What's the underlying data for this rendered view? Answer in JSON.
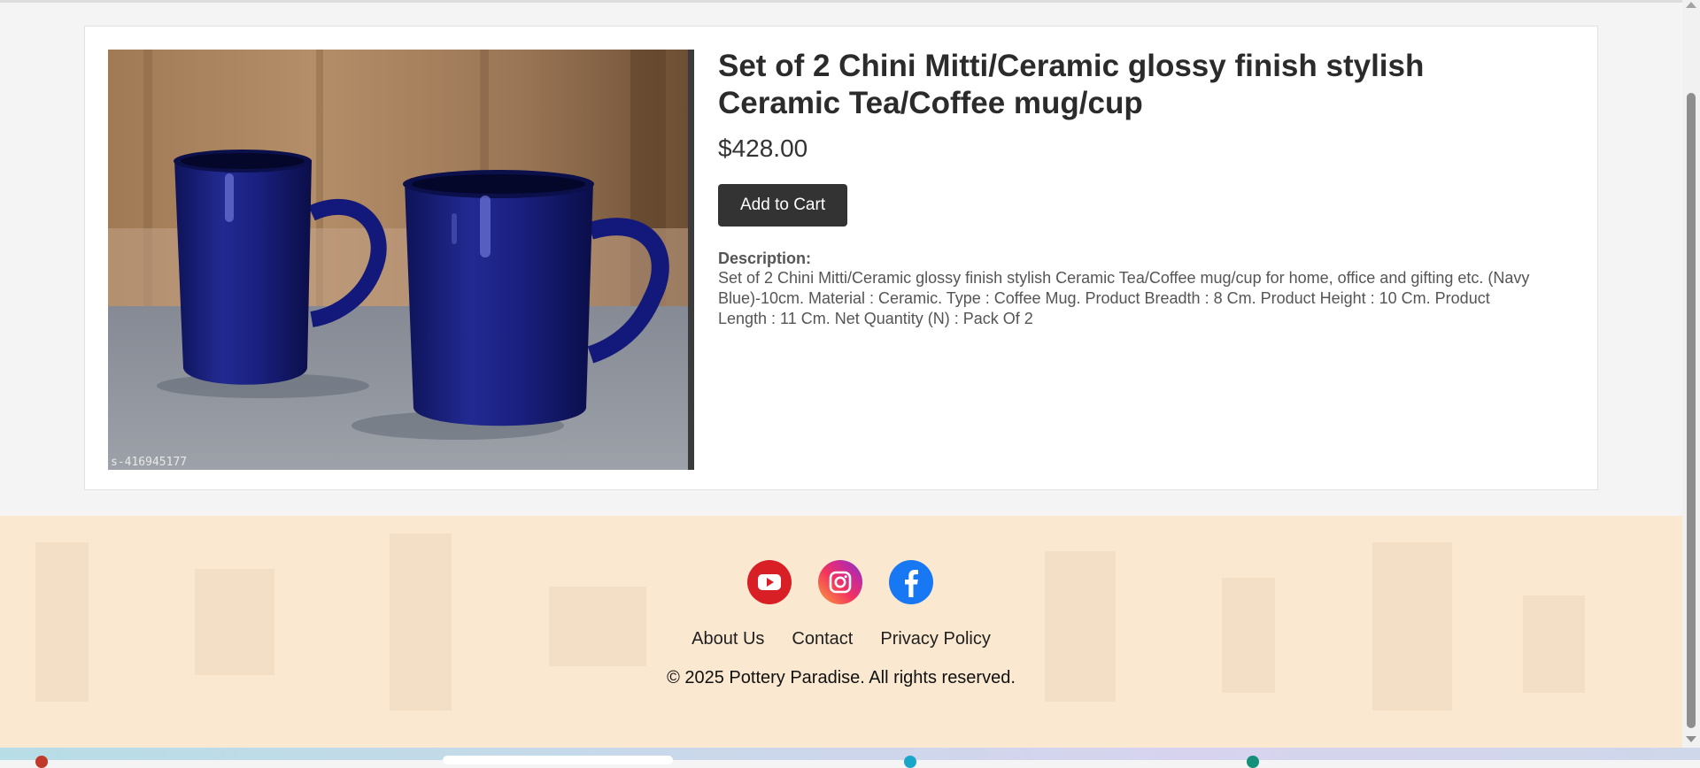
{
  "product": {
    "title": "Set of 2 Chini Mitti/Ceramic glossy finish stylish Ceramic Tea/Coffee mug/cup",
    "price": "$428.00",
    "add_to_cart_label": "Add to Cart",
    "description_label": "Description:",
    "description": "Set of 2 Chini Mitti/Ceramic glossy finish stylish Ceramic Tea/Coffee mug/cup for home, office and gifting etc. (Navy Blue)-10cm. Material : Ceramic. Type : Coffee Mug. Product Breadth : 8 Cm. Product Height : 10 Cm. Product Length : 11 Cm. Net Quantity (N) : Pack Of 2",
    "image_watermark": "s-416945177",
    "image_alt": "Two navy blue ceramic mugs"
  },
  "footer": {
    "socials": [
      {
        "name": "YouTube",
        "icon": "youtube-icon",
        "color": "#d81f26"
      },
      {
        "name": "Instagram",
        "icon": "instagram-icon",
        "color": "#e1306c"
      },
      {
        "name": "Facebook",
        "icon": "facebook-icon",
        "color": "#1877f2"
      }
    ],
    "links": [
      "About Us",
      "Contact",
      "Privacy Policy"
    ],
    "copyright": "© 2025 Pottery Paradise. All rights reserved."
  },
  "colors": {
    "button_bg": "#333333",
    "footer_bg": "#fae8d0",
    "mug_color": "#1a1f7a"
  }
}
